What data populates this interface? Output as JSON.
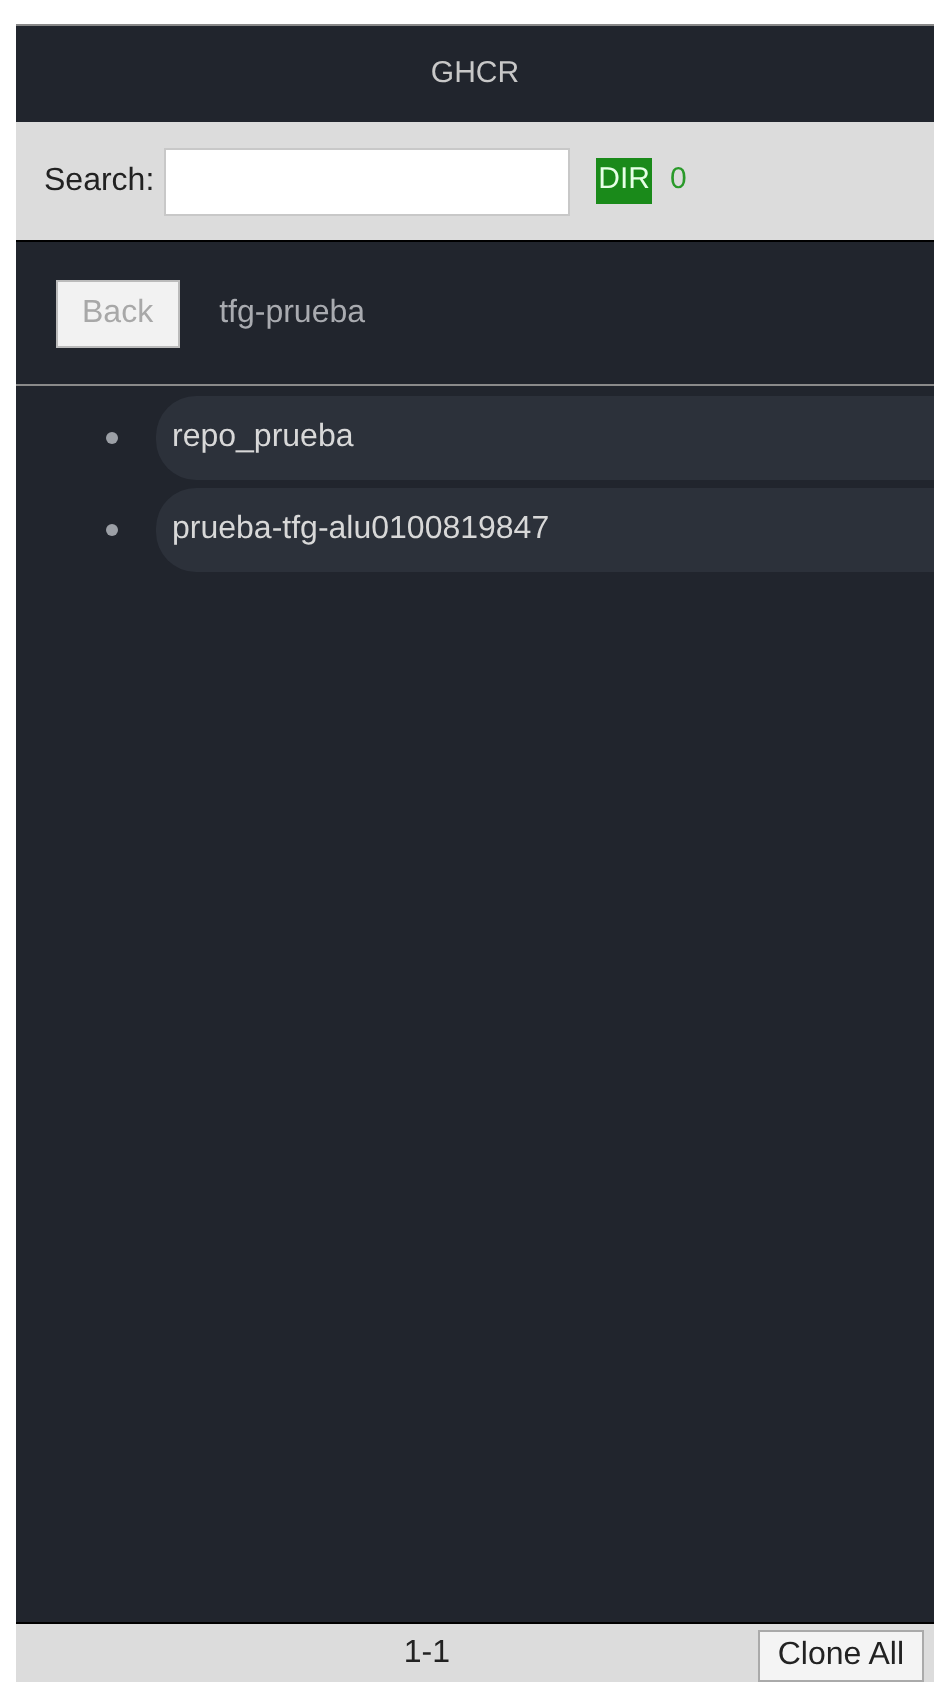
{
  "title": "GHCR",
  "search": {
    "label": "Search:",
    "badge": "DIR",
    "count": "0"
  },
  "nav": {
    "back": "Back",
    "back_disabled": true,
    "path": "tfg-prueba"
  },
  "items": [
    {
      "label": "repo_prueba"
    },
    {
      "label": "prueba-tfg-alu0100819847"
    }
  ],
  "footer": {
    "range": "1-1",
    "button": "Clone All"
  }
}
